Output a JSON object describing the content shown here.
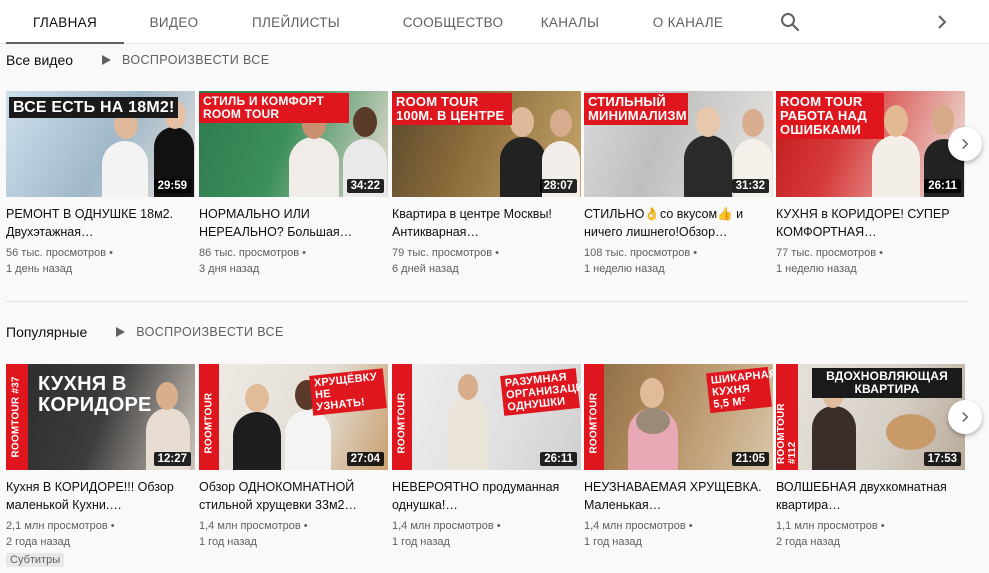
{
  "tabs": [
    {
      "label": "Главная",
      "active": true
    },
    {
      "label": "Видео"
    },
    {
      "label": "Плейлисты"
    },
    {
      "label": "Сообщество"
    },
    {
      "label": "Каналы"
    },
    {
      "label": "О канале"
    }
  ],
  "icons": {
    "search": "search-icon",
    "next": "chevron-right-icon",
    "play": "play-icon"
  },
  "colors": {
    "accent": "#e0161e",
    "text": "#0f0f0f",
    "secondary": "#606060"
  },
  "sections": [
    {
      "title": "Все видео",
      "play_all": "ВОСПРОИЗВЕСТИ ВСЕ",
      "videos": [
        {
          "thumb_text": "ВСЕ ЕСТЬ НА 18м2!",
          "duration": "29:59",
          "title": "РЕМОНТ В ОДНУШКЕ 18м2. Двухэтажная…",
          "views": "56 тыс. просмотров",
          "age": "1 день назад"
        },
        {
          "thumb_text": "СТИЛЬ И КОМФОРТ ROOM TOUR",
          "duration": "34:22",
          "title": "НОРМАЛЬНО ИЛИ НЕРЕАЛЬНО? Большая…",
          "views": "86 тыс. просмотров",
          "age": "3 дня назад"
        },
        {
          "thumb_text": "ROOM TOUR 100м. В ЦЕНТРЕ",
          "duration": "28:07",
          "title": "Квартира в центре Москвы! Антикварная…",
          "views": "79 тыс. просмотров",
          "age": "6 дней назад"
        },
        {
          "thumb_text": "СТИЛЬНЫЙ МИНИМАЛИЗМ",
          "duration": "31:32",
          "title": "СТИЛЬНО👌со вкусом👍 и ничего лишнего!Обзор…",
          "views": "108 тыс. просмотров",
          "age": "1 неделю назад"
        },
        {
          "thumb_text": "ROOM TOUR РАБОТА НАД ОШИБКАМИ",
          "duration": "26:11",
          "title": "КУХНЯ в КОРИДОРЕ! СУПЕР КОМФОРТНАЯ…",
          "views": "77 тыс. просмотров",
          "age": "1 неделю назад"
        }
      ]
    },
    {
      "title": "Популярные",
      "play_all": "ВОСПРОИЗВЕСТИ ВСЕ",
      "videos": [
        {
          "thumb_text": "КУХНЯ В КОРИДОРЕ",
          "side_text": "ROOMTOUR #37",
          "duration": "12:27",
          "title": "Кухня В КОРИДОРЕ!!! Обзор маленькой Кухни.…",
          "views": "2,1 млн просмотров",
          "age": "2 года назад",
          "badge": "Субтитры"
        },
        {
          "thumb_text": "ХРУЩЁВКУ НЕ УЗНАТЬ!",
          "side_text": "ROOMTOUR",
          "duration": "27:04",
          "title": "Обзор ОДНОКОМНАТНОЙ стильной хрущевки 33м2…",
          "views": "1,4 млн просмотров",
          "age": "1 год назад"
        },
        {
          "thumb_text": "РАЗУМНАЯ ОРГАНИЗАЦИЯ ОДНУШКИ",
          "side_text": "ROOMTOUR",
          "duration": "26:11",
          "title": "НЕВЕРОЯТНО продуманная однушка!…",
          "views": "1,4 млн просмотров",
          "age": "1 год назад"
        },
        {
          "thumb_text": "ШИКАРНАЯ КУХНЯ 5,5 м²",
          "side_text": "ROOMTOUR",
          "duration": "21:05",
          "title": "НЕУЗНАВАЕМАЯ ХРУЩЕВКА. Маленькая…",
          "views": "1,4 млн просмотров",
          "age": "1 год назад"
        },
        {
          "thumb_text": "ВДОХНОВЛЯЮЩАЯ КВАРТИРА",
          "side_text": "ROOMTOUR #112",
          "duration": "17:53",
          "title": "ВОЛШЕБНАЯ двухкомнатная квартира…",
          "views": "1,1 млн просмотров",
          "age": "2 года назад"
        }
      ]
    }
  ]
}
